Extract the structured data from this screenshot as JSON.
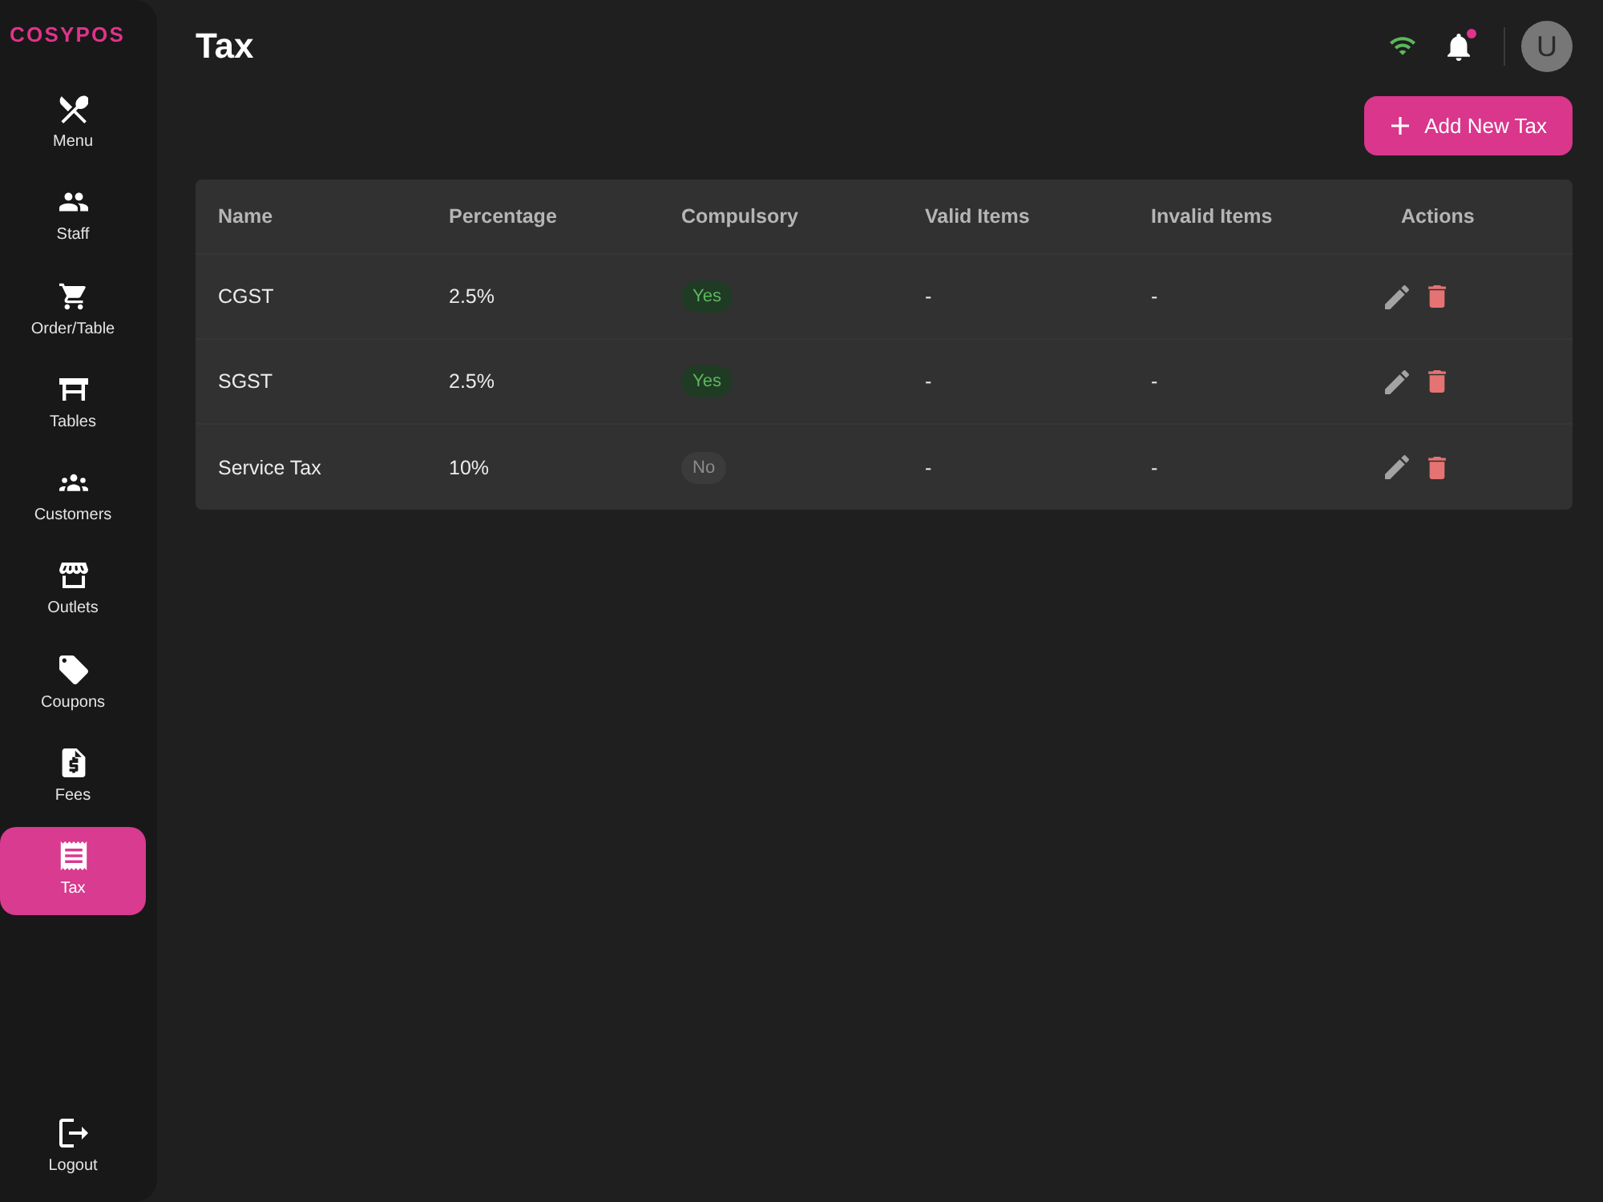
{
  "sidebar": {
    "logo": "COSYPOS",
    "items": [
      {
        "label": "Menu",
        "selected": false
      },
      {
        "label": "Staff",
        "selected": false
      },
      {
        "label": "Order/Table",
        "selected": false
      },
      {
        "label": "Tables",
        "selected": false
      },
      {
        "label": "Customers",
        "selected": false
      },
      {
        "label": "Outlets",
        "selected": false
      },
      {
        "label": "Coupons",
        "selected": false
      },
      {
        "label": "Fees",
        "selected": false
      },
      {
        "label": "Tax",
        "selected": true
      }
    ],
    "logout": {
      "label": "Logout"
    }
  },
  "header": {
    "title": "Tax",
    "notifications": {
      "unread": true
    },
    "avatar": {
      "initial": "U"
    }
  },
  "toolbar": {
    "add_button": {
      "label": "Add New Tax"
    }
  },
  "table": {
    "columns": [
      "Name",
      "Percentage",
      "Compulsory",
      "Valid Items",
      "Invalid Items",
      "Actions"
    ],
    "rows": [
      {
        "name": "CGST",
        "percentage": "2.5%",
        "compulsory": {
          "label": "Yes",
          "on": true
        },
        "valid_items": "-",
        "invalid_items": "-"
      },
      {
        "name": "SGST",
        "percentage": "2.5%",
        "compulsory": {
          "label": "Yes",
          "on": true
        },
        "valid_items": "-",
        "invalid_items": "-"
      },
      {
        "name": "Service Tax",
        "percentage": "10%",
        "compulsory": {
          "label": "No",
          "on": false
        },
        "valid_items": "-",
        "invalid_items": "-"
      }
    ]
  }
}
